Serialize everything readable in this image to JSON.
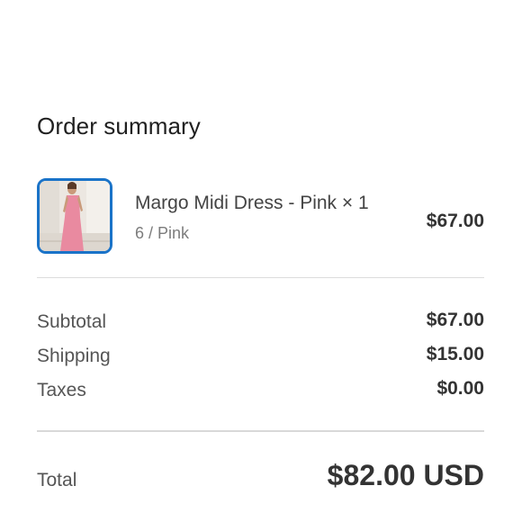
{
  "order_summary": {
    "title": "Order summary",
    "items": [
      {
        "name": "Margo Midi Dress - Pink × 1",
        "variant": "6 / Pink",
        "price": "$67.00",
        "thumbnail_icon": "dress-product-image"
      }
    ],
    "subtotal": {
      "label": "Subtotal",
      "value": "$67.00"
    },
    "shipping": {
      "label": "Shipping",
      "value": "$15.00"
    },
    "taxes": {
      "label": "Taxes",
      "value": "$0.00"
    },
    "total": {
      "label": "Total",
      "value": "$82.00 USD"
    }
  },
  "colors": {
    "thumbnail_border": "#1a73c8",
    "product_pink": "#e98aa0"
  }
}
